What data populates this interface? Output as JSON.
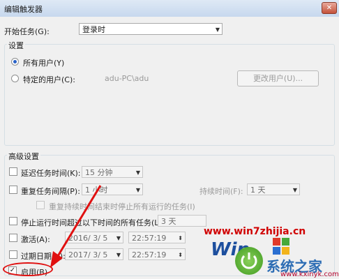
{
  "window": {
    "title": "编辑触发器",
    "close_glyph": "✕"
  },
  "begin_task": {
    "label": "开始任务(G):",
    "value": "登录时"
  },
  "settings": {
    "title": "设置",
    "all_users": "所有用户(Y)",
    "specific_user": "特定的用户(C):",
    "user_value": "adu-PC\\adu",
    "change_user_button": "更改用户(U)..."
  },
  "advanced": {
    "title": "高级设置",
    "delay": {
      "label": "延迟任务时间(K):",
      "value": "15 分钟"
    },
    "repeat": {
      "label": "重复任务间隔(P):",
      "value": "1 小时",
      "duration_label": "持续时间(F):",
      "duration_value": "1 天"
    },
    "stop_repeat": "重复持续时间结束时停止所有运行的任务(I)",
    "stop_long": {
      "label": "停止运行时间超过以下时间的所有任务(L):",
      "value": "3 天"
    },
    "activate": {
      "label": "激活(A):",
      "date": "2016/ 3/ 5",
      "time": "22:57:19"
    },
    "expire": {
      "label": "过期日期(X):",
      "date": "2017/ 3/ 5",
      "time": "22:57:19"
    },
    "enabled": {
      "label": "启用(B)",
      "checked_glyph": "✓"
    }
  },
  "watermarks": {
    "site1": "www.win7zhijia.cn",
    "site2": "www.kxinyk.com",
    "logo_text": "Win",
    "logo_cn": "系统之家"
  },
  "colors": {
    "annotation": "#e01010",
    "watermark_text": "#d00000"
  }
}
